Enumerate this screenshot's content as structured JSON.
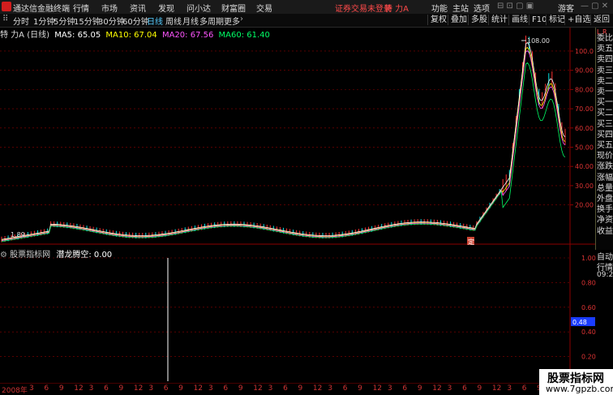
{
  "topbar": {
    "app_title": "通达信金融终端",
    "menus": [
      "行情",
      "市场",
      "资讯",
      "发现",
      "问小达",
      "财富圈",
      "交易"
    ],
    "center_notice": "证券交易未登录",
    "stock": "特 力A",
    "right_menus": [
      "功能",
      "主站",
      "选项"
    ],
    "guest": "游客"
  },
  "toolbar": {
    "periods": [
      "分时",
      "1分钟",
      "5分钟",
      "15分钟",
      "30分钟",
      "60分钟",
      "日线",
      "周线",
      "月线",
      "多周期",
      "更多"
    ],
    "active": "日线",
    "right_buttons": [
      "复权",
      "叠加",
      "多股",
      "统计",
      "画线",
      "F10",
      "标记",
      "+自选",
      "返回"
    ]
  },
  "chart_header": {
    "name": "特 力A (日线)",
    "ma5": "MA5: 65.05",
    "ma10": "MA10: 67.04",
    "ma20": "MA20: 67.56",
    "ma60": "MA60: 61.40"
  },
  "price_axis": [
    "100.0",
    "90.00",
    "80.00",
    "70.00",
    "60.00",
    "50.00",
    "40.00",
    "30.00",
    "20.00"
  ],
  "peak_label": "108.00",
  "low_label": "1.89",
  "marker_label": "定",
  "indicator": {
    "source": "股票指标网",
    "name": "潜龙腾空:",
    "value": "0.00",
    "axis": [
      "1.00",
      "0.80",
      "0.60",
      "0.40",
      "0.20"
    ],
    "highlight": "0.48"
  },
  "quote_panel": [
    "委比",
    "卖五",
    "卖四",
    "卖三",
    "卖二",
    "卖一",
    "买一",
    "买二",
    "买三",
    "买四",
    "买五",
    "现价",
    "涨跌",
    "涨幅",
    "总量",
    "外盘",
    "换手",
    "净资",
    "收益"
  ],
  "quote_extra": [
    "自动",
    "行情",
    "09:25"
  ],
  "quote_tag": "L R",
  "xaxis": {
    "year": "2008年",
    "ticks": [
      "3",
      "6",
      "9",
      "12",
      "3",
      "6",
      "9",
      "12",
      "3",
      "6",
      "9",
      "12",
      "3",
      "6",
      "9",
      "12",
      "3",
      "6",
      "9",
      "12",
      "3",
      "6",
      "9",
      "12",
      "3",
      "6",
      "9",
      "12",
      "3",
      "6",
      "9",
      "12",
      "3",
      "6",
      "9",
      "12"
    ]
  },
  "watermark": {
    "line1": "股票指标网",
    "line2": "www.7gpzb.com"
  },
  "colors": {
    "ma5": "#ffffff",
    "ma10": "#ffff00",
    "ma20": "#ff55ff",
    "ma60": "#00ff66",
    "grid": "#8b0000",
    "up": "#ff3030",
    "down": "#00e0e0",
    "highlight_bg": "#1a3cff"
  }
}
